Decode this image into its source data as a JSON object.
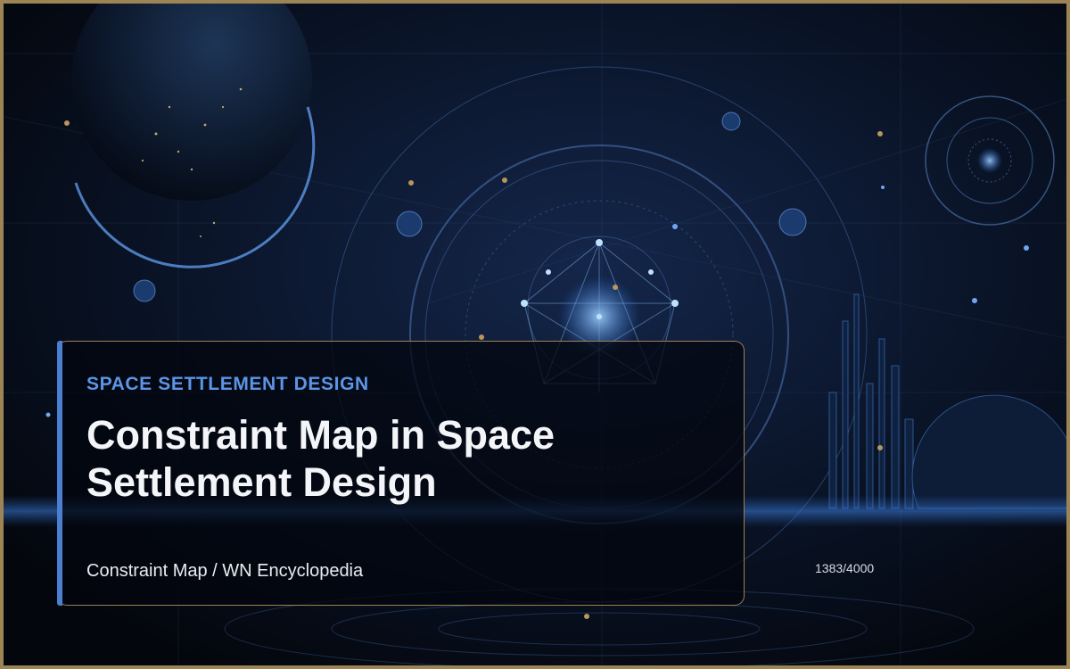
{
  "card": {
    "kicker": "SPACE SETTLEMENT DESIGN",
    "title": "Constraint Map in Space Settlement Design",
    "subtitle": "Constraint Map / WN Encyclopedia"
  },
  "progress": {
    "label": "1383/4000"
  },
  "colors": {
    "background": "#05080f",
    "frame": "#9c8455",
    "accent": "#4a7fd1",
    "kicker": "#5c95e6",
    "card_border": "#b8965c"
  },
  "background_image": "space-settlement-blueprint-illustration"
}
